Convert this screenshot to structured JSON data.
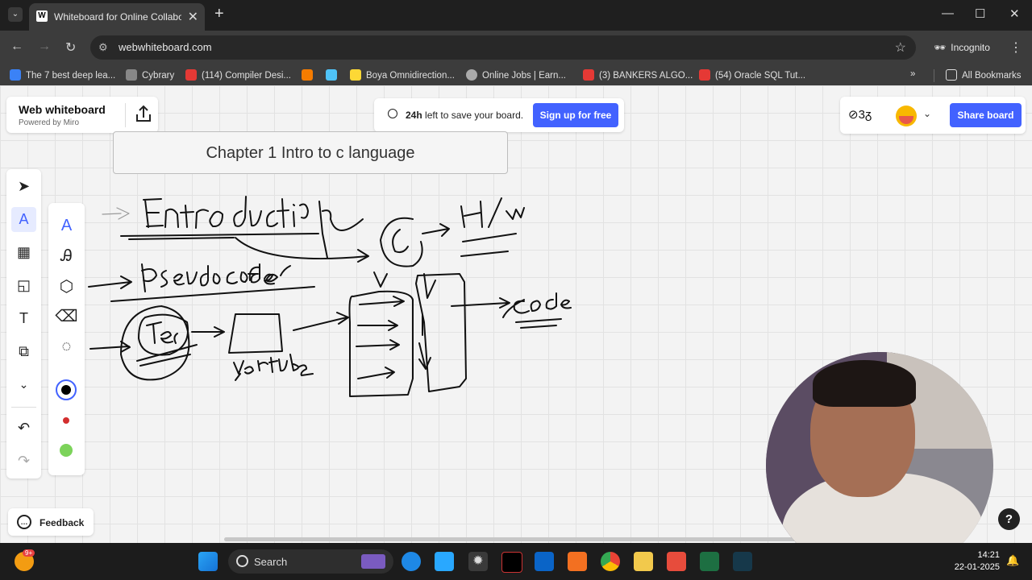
{
  "browser": {
    "tab_title": "Whiteboard for Online Collabor",
    "tab_favicon_letter": "W",
    "url": "webwhiteboard.com",
    "incognito_label": "Incognito",
    "bookmarks": [
      {
        "label": "The 7 best deep lea...",
        "color": "#3b82f6"
      },
      {
        "label": "Cybrary",
        "color": "#888888"
      },
      {
        "label": "(114) Compiler Desi...",
        "color": "#e53935"
      },
      {
        "label": "",
        "color": "#f57c00"
      },
      {
        "label": "",
        "color": "#4fc3f7"
      },
      {
        "label": "Boya Omnidirection...",
        "color": "#fdd835"
      },
      {
        "label": "Online Jobs | Earn...",
        "color": "#aaaaaa"
      },
      {
        "label": "(3) BANKERS ALGO...",
        "color": "#e53935"
      },
      {
        "label": "(54) Oracle SQL Tut...",
        "color": "#e53935"
      }
    ],
    "all_bookmarks": "All Bookmarks"
  },
  "app": {
    "name": "Web whiteboard",
    "powered_by": "Powered by Miro",
    "timer_hours": "24h",
    "timer_text": "left to save your board.",
    "signup_label": "Sign up for free",
    "share_label": "Share board",
    "board_title": "Chapter 1 Intro to c language",
    "feedback_label": "Feedback",
    "help_label": "?",
    "pen_colors": [
      "#000000",
      "#d32f2f",
      "#7cd35a"
    ]
  },
  "taskbar": {
    "search_label": "Search",
    "time": "14:21",
    "date": "22-01-2025",
    "notif_badge": "9+"
  }
}
